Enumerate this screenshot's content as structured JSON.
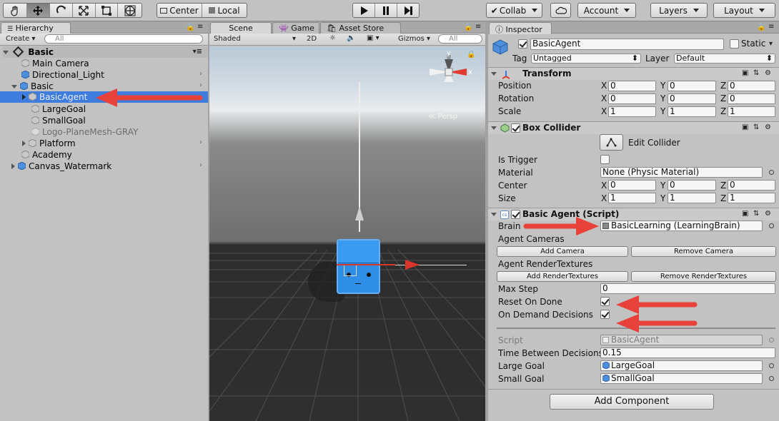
{
  "toolbar": {
    "pivot_label": "Center",
    "space_label": "Local",
    "collab_label": "Collab",
    "account_label": "Account",
    "layers_label": "Layers",
    "layout_label": "Layout"
  },
  "hierarchy": {
    "tab": "Hierarchy",
    "create_label": "Create",
    "search_placeholder": "All",
    "scene_name": "Basic",
    "items": [
      {
        "label": "Main Camera"
      },
      {
        "label": "Directional_Light"
      },
      {
        "label": "Basic"
      },
      {
        "label": "BasicAgent"
      },
      {
        "label": "LargeGoal"
      },
      {
        "label": "SmallGoal"
      },
      {
        "label": "Logo-PlaneMesh-GRAY"
      },
      {
        "label": "Platform"
      },
      {
        "label": "Academy"
      },
      {
        "label": "Canvas_Watermark"
      }
    ]
  },
  "scene": {
    "tabs": [
      "Scene",
      "Game",
      "Asset Store"
    ],
    "shading": "Shaded",
    "mode_2d": "2D",
    "gizmos": "Gizmos",
    "search_placeholder": "All",
    "persp_label": "Persp",
    "gizmo_axes": {
      "y": "y",
      "x": "x"
    }
  },
  "inspector": {
    "tab": "Inspector",
    "object_name": "BasicAgent",
    "static_label": "Static",
    "tag_label": "Tag",
    "tag_value": "Untagged",
    "layer_label": "Layer",
    "layer_value": "Default",
    "transform": {
      "title": "Transform",
      "position_label": "Position",
      "rotation_label": "Rotation",
      "scale_label": "Scale",
      "position": {
        "x": "0",
        "y": "0",
        "z": "0"
      },
      "rotation": {
        "x": "0",
        "y": "0",
        "z": "0"
      },
      "scale": {
        "x": "1",
        "y": "1",
        "z": "1"
      }
    },
    "box_collider": {
      "title": "Box Collider",
      "edit_collider": "Edit Collider",
      "is_trigger_label": "Is Trigger",
      "is_trigger": false,
      "material_label": "Material",
      "material_value": "None (Physic Material)",
      "center_label": "Center",
      "size_label": "Size",
      "center": {
        "x": "0",
        "y": "0",
        "z": "0"
      },
      "size": {
        "x": "1",
        "y": "1",
        "z": "1"
      }
    },
    "basic_agent": {
      "title": "Basic Agent (Script)",
      "brain_label": "Brain",
      "brain_value": "BasicLearning (LearningBrain)",
      "agent_cameras_label": "Agent Cameras",
      "add_camera": "Add Camera",
      "remove_camera": "Remove Camera",
      "render_textures_label": "Agent RenderTextures",
      "add_render_textures": "Add RenderTextures",
      "remove_render_textures": "Remove RenderTextures",
      "max_step_label": "Max Step",
      "max_step_value": "0",
      "reset_on_done_label": "Reset On Done",
      "reset_on_done": true,
      "on_demand_label": "On Demand Decisions",
      "on_demand": true,
      "script_label": "Script",
      "script_value": "BasicAgent",
      "time_between_label": "Time Between Decisions",
      "time_between_value": "0.15",
      "large_goal_label": "Large Goal",
      "large_goal_value": "LargeGoal",
      "small_goal_label": "Small Goal",
      "small_goal_value": "SmallGoal"
    },
    "add_component": "Add Component"
  },
  "colors": {
    "selection": "#3e7ddd",
    "annotation_arrow": "#e8413a",
    "cube_blue": "#2f8ee6"
  }
}
